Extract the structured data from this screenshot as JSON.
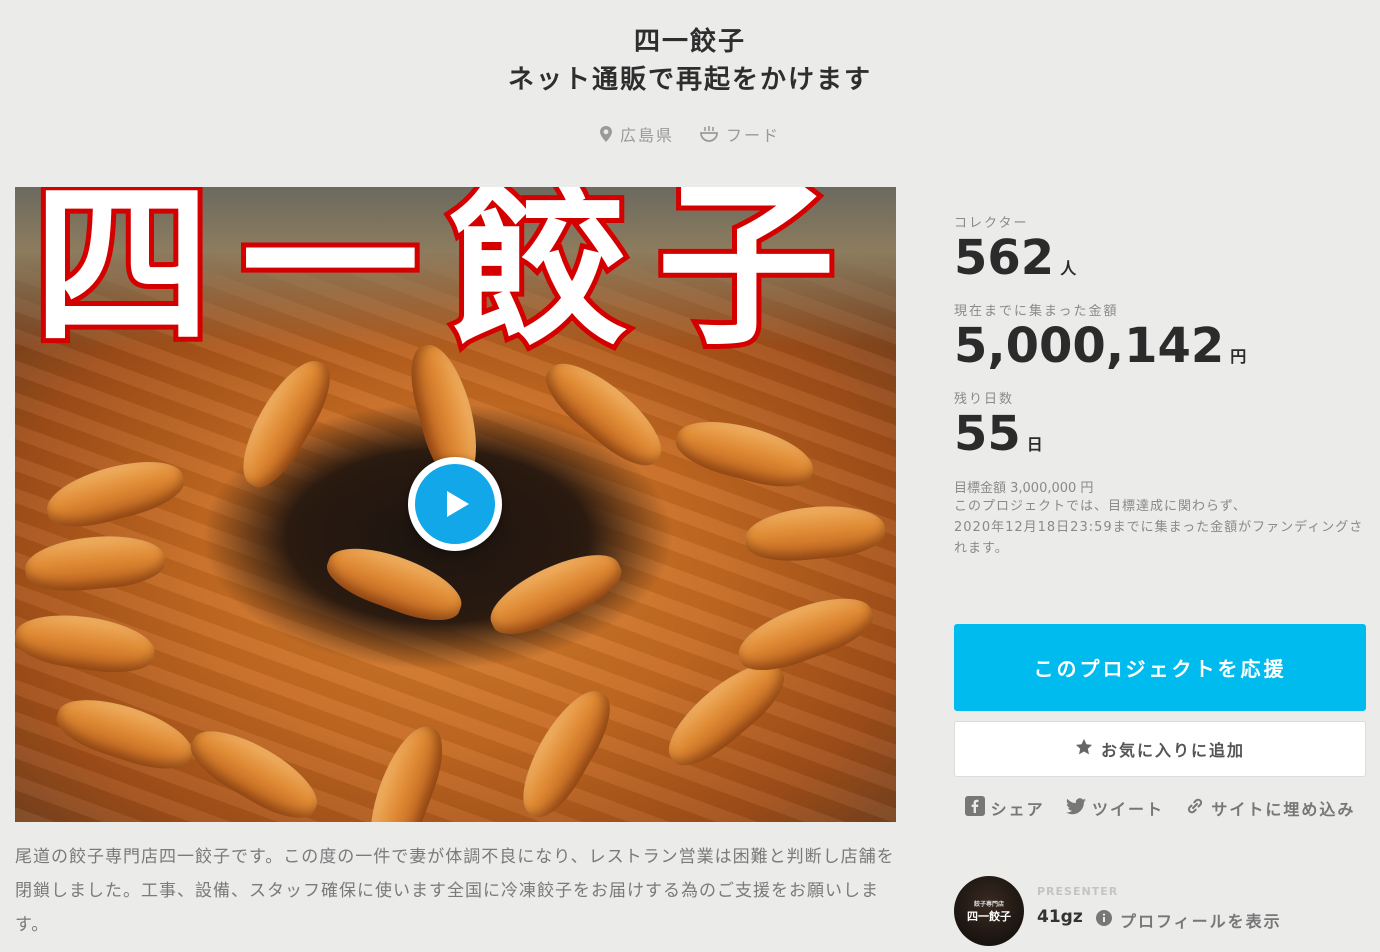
{
  "header": {
    "title_line1": "四一餃子",
    "title_line2": "ネット通販で再起をかけます"
  },
  "meta": {
    "location": "広島県",
    "category": "フード",
    "location_icon": "map-pin-icon",
    "category_icon": "food-bowl-icon"
  },
  "hero": {
    "overlay_text": "四一餃子",
    "play_icon": "play-icon"
  },
  "description": "尾道の餃子専門店四一餃子です。この度の一件で妻が体調不良になり、レストラン営業は困難と判断し店舗を閉鎖しました。工事、設備、スタッフ確保に使います全国に冷凍餃子をお届けする為のご支援をお願いします。",
  "stats": {
    "collectors_label": "コレクター",
    "collectors_value": "562",
    "collectors_unit": "人",
    "raised_label": "現在までに集まった金額",
    "raised_value": "5,000,142",
    "raised_unit": "円",
    "days_label": "残り日数",
    "days_value": "55",
    "days_unit": "日",
    "goal": "目標金額 3,000,000 円",
    "note_line1": "このプロジェクトでは、目標達成に関わらず、",
    "note_line2": "2020年12月18日23:59までに集まった金額がファンディングされます。"
  },
  "actions": {
    "support_label": "このプロジェクトを応援",
    "favorite_label": "お気に入りに追加",
    "share_label": "シェア",
    "tweet_label": "ツイート",
    "embed_label": "サイトに埋め込み"
  },
  "presenter": {
    "label": "PRESENTER",
    "name": "41gz",
    "profile_link": "プロフィールを表示",
    "avatar_small": "餃子専門店",
    "avatar_text": "四一餃子"
  },
  "colors": {
    "accent": "#00bbee",
    "background": "#ebebea",
    "hero_text_stroke": "#d40000"
  }
}
